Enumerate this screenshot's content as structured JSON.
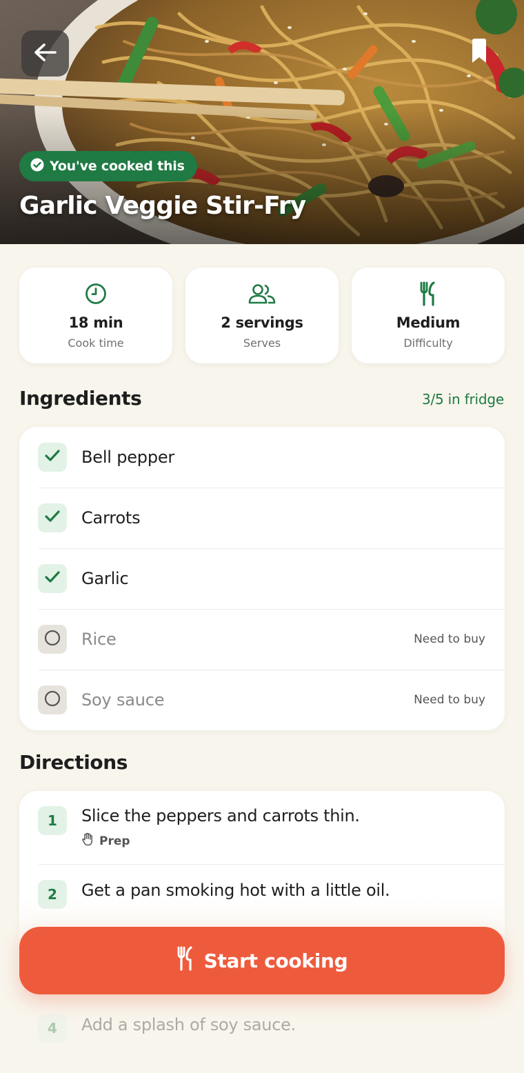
{
  "hero": {
    "cooked_badge": "You've cooked this",
    "title": "Garlic Veggie Stir-Fry"
  },
  "stats": [
    {
      "icon": "clock-icon",
      "value": "18 min",
      "label": "Cook time"
    },
    {
      "icon": "people-icon",
      "value": "2 servings",
      "label": "Serves"
    },
    {
      "icon": "utensils-icon",
      "value": "Medium",
      "label": "Difficulty"
    }
  ],
  "ingredients": {
    "title": "Ingredients",
    "fridge_count": "3/5 in fridge",
    "items": [
      {
        "name": "Bell pepper",
        "have": true,
        "tag": ""
      },
      {
        "name": "Carrots",
        "have": true,
        "tag": ""
      },
      {
        "name": "Garlic",
        "have": true,
        "tag": ""
      },
      {
        "name": "Rice",
        "have": false,
        "tag": "Need to buy"
      },
      {
        "name": "Soy sauce",
        "have": false,
        "tag": "Need to buy"
      }
    ]
  },
  "directions": {
    "title": "Directions",
    "steps": [
      {
        "number": "1",
        "text": "Slice the peppers and carrots thin.",
        "tag": "Prep"
      },
      {
        "number": "2",
        "text": "Get a pan smoking hot with a little oil."
      },
      {
        "number": "4",
        "text": "Add a splash of soy sauce."
      }
    ]
  },
  "cta": {
    "label": "Start cooking",
    "icon": "utensils-icon"
  },
  "colors": {
    "accent_green": "#1f7a44",
    "cta_orange": "#ee5b3c",
    "background": "#f8f5ec"
  }
}
